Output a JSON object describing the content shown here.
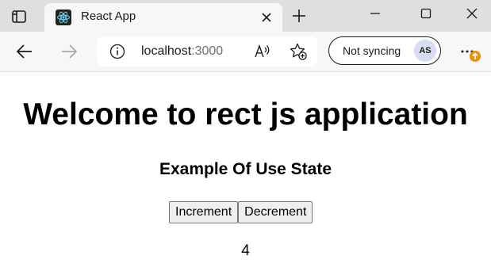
{
  "browser": {
    "tab": {
      "title": "React App",
      "favicon": "react-logo-icon"
    },
    "address_bar": {
      "host": "localhost",
      "port": ":3000"
    },
    "profile": {
      "sync_status": "Not syncing",
      "initials": "AS"
    },
    "icons": {
      "tab_actions": "tab-actions-icon",
      "close_tab": "close-icon",
      "new_tab": "plus-icon",
      "minimize": "minimize-icon",
      "maximize": "maximize-icon",
      "close_window": "close-window-icon",
      "back": "back-arrow-icon",
      "forward": "forward-arrow-icon",
      "site_info": "info-icon",
      "read_aloud": "read-aloud-icon",
      "add_favorite": "add-favorite-icon",
      "more": "more-icon",
      "update": "update-arrow-icon"
    },
    "colors": {
      "tab_strip": "#dfdfdf",
      "toolbar": "#f7f7f7",
      "update_badge": "#e8910c",
      "avatar_bg": "#d6dff0"
    }
  },
  "page": {
    "title": "Welcome to rect js application",
    "subtitle": "Example Of Use State",
    "increment_label": "Increment",
    "decrement_label": "Decrement",
    "count": "4"
  }
}
